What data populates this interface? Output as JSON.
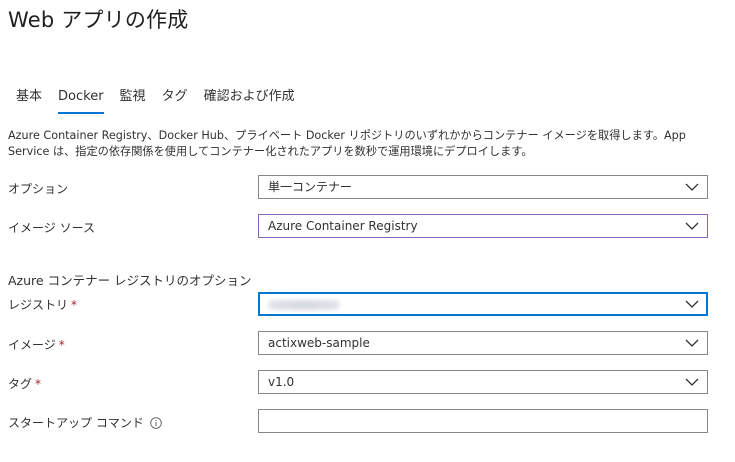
{
  "title": "Web アプリの作成",
  "tabs": [
    {
      "label": "基本",
      "active": false
    },
    {
      "label": "Docker",
      "active": true
    },
    {
      "label": "監視",
      "active": false
    },
    {
      "label": "タグ",
      "active": false
    },
    {
      "label": "確認および作成",
      "active": false
    }
  ],
  "description": "Azure Container Registry、Docker Hub、プライベート Docker リポジトリのいずれかからコンテナー イメージを取得します。App Service は、指定の依存関係を使用してコンテナー化されたアプリを数秒で運用環境にデプロイします。",
  "fields": {
    "options": {
      "label": "オプション",
      "value": "単一コンテナー"
    },
    "image_source": {
      "label": "イメージ ソース",
      "value": "Azure Container Registry"
    }
  },
  "acr_section": {
    "heading": "Azure コンテナー レジストリのオプション",
    "registry": {
      "label": "レジストリ",
      "required_marker": "*"
    },
    "image": {
      "label": "イメージ",
      "required_marker": "*",
      "value": "actixweb-sample"
    },
    "tag": {
      "label": "タグ",
      "required_marker": "*",
      "value": "v1.0"
    },
    "startup_command": {
      "label": "スタートアップ コマンド",
      "value": ""
    }
  },
  "colors": {
    "accent": "#0078d4",
    "required": "#a4262c",
    "active_border": "#8764b8"
  },
  "icons": {
    "dropdown": "chevron-down-icon",
    "info": "info-icon"
  }
}
